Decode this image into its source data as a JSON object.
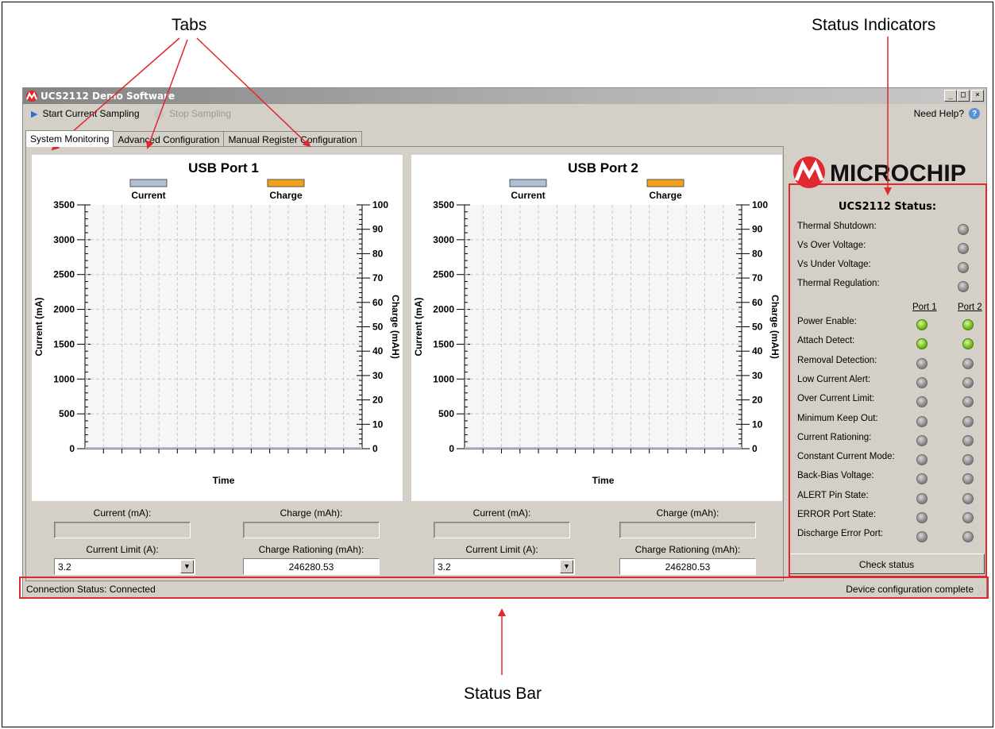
{
  "callouts": {
    "tabs": "Tabs",
    "status_indicators": "Status Indicators",
    "status_bar": "Status Bar"
  },
  "window": {
    "title": "UCS2112 Demo Software",
    "controls": [
      "_",
      "□",
      "×"
    ]
  },
  "toolbar": {
    "start": "Start Current Sampling",
    "stop": "Stop Sampling",
    "help": "Need Help?"
  },
  "tabs": [
    "System Monitoring",
    "Advanced Configuration",
    "Manual Register Configuration"
  ],
  "ports": [
    {
      "title": "USB Port 1",
      "current_label": "Current (mA):",
      "current_value": "",
      "charge_label": "Charge (mAh):",
      "charge_value": "",
      "limit_label": "Current Limit (A):",
      "limit_value": "3.2",
      "rationing_label": "Charge Rationing (mAh):",
      "rationing_value": "246280.53"
    },
    {
      "title": "USB Port 2",
      "current_label": "Current (mA):",
      "current_value": "",
      "charge_label": "Charge (mAh):",
      "charge_value": "",
      "limit_label": "Current Limit (A):",
      "limit_value": "3.2",
      "rationing_label": "Charge Rationing (mAh):",
      "rationing_value": "246280.53"
    }
  ],
  "chart_data": [
    {
      "type": "line",
      "title": "USB Port 1",
      "xlabel": "Time",
      "ylabel": "Current (mA)",
      "y2label": "Charge (mAH)",
      "ylim": [
        0,
        3500
      ],
      "y2lim": [
        0,
        100
      ],
      "yticks": [
        "0",
        "500",
        "1000",
        "1500",
        "2000",
        "2500",
        "3000",
        "3500"
      ],
      "y2ticks": [
        "0",
        "10",
        "20",
        "30",
        "40",
        "50",
        "60",
        "70",
        "80",
        "90",
        "100"
      ],
      "legend": "top",
      "grid": true,
      "series": [
        {
          "name": "Current",
          "color": "#b0bed6",
          "values": [
            0,
            0
          ]
        },
        {
          "name": "Charge",
          "color": "#f4a21c",
          "values": [
            0,
            0
          ]
        }
      ]
    },
    {
      "type": "line",
      "title": "USB Port 2",
      "xlabel": "Time",
      "ylabel": "Current (mA)",
      "y2label": "Charge (mAH)",
      "ylim": [
        0,
        3500
      ],
      "y2lim": [
        0,
        100
      ],
      "yticks": [
        "0",
        "500",
        "1000",
        "1500",
        "2000",
        "2500",
        "3000",
        "3500"
      ],
      "y2ticks": [
        "0",
        "10",
        "20",
        "30",
        "40",
        "50",
        "60",
        "70",
        "80",
        "90",
        "100"
      ],
      "legend": "top",
      "grid": true,
      "series": [
        {
          "name": "Current",
          "color": "#b0bed6",
          "values": [
            0,
            0
          ]
        },
        {
          "name": "Charge",
          "color": "#f4a21c",
          "values": [
            0,
            0
          ]
        }
      ]
    }
  ],
  "logo": {
    "text": "MICROCHIP",
    "color": "#e0282e"
  },
  "status": {
    "title": "UCS2112 Status:",
    "global": [
      {
        "label": "Thermal Shutdown:",
        "on": false
      },
      {
        "label": "Vs Over Voltage:",
        "on": false
      },
      {
        "label": "Vs Under Voltage:",
        "on": false
      },
      {
        "label": "Thermal Regulation:",
        "on": false
      }
    ],
    "port_headers": [
      "Port 1",
      "Port 2"
    ],
    "per_port": [
      {
        "label": "Power Enable:",
        "p1": true,
        "p2": true
      },
      {
        "label": "Attach Detect:",
        "p1": true,
        "p2": true
      },
      {
        "label": "Removal Detection:",
        "p1": false,
        "p2": false
      },
      {
        "label": "Low Current Alert:",
        "p1": false,
        "p2": false
      },
      {
        "label": "Over Current Limit:",
        "p1": false,
        "p2": false
      },
      {
        "label": "Minimum Keep Out:",
        "p1": false,
        "p2": false
      },
      {
        "label": "Current Rationing:",
        "p1": false,
        "p2": false
      },
      {
        "label": "Constant Current Mode:",
        "p1": false,
        "p2": false
      },
      {
        "label": "Back-Bias Voltage:",
        "p1": false,
        "p2": false
      },
      {
        "label": "ALERT Pin State:",
        "p1": false,
        "p2": false
      },
      {
        "label": "ERROR Port State:",
        "p1": false,
        "p2": false
      },
      {
        "label": "Discharge Error Port:",
        "p1": false,
        "p2": false
      }
    ],
    "check_button": "Check status"
  },
  "statusbar": {
    "left": "Connection Status:  Connected",
    "right": "Device configuration complete"
  },
  "colors": {
    "annotation": "#e0282e",
    "window_bg": "#d4d0c8"
  }
}
